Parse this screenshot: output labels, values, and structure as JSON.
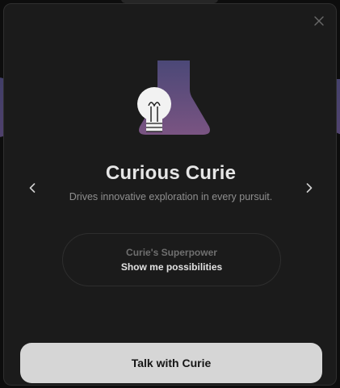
{
  "persona": {
    "name": "Curious Curie",
    "tagline": "Drives innovative exploration in every pursuit.",
    "art_icons": [
      "lightbulb-icon",
      "flask-icon"
    ]
  },
  "superpower": {
    "label": "Curie's Superpower",
    "value": "Show me possibilities"
  },
  "cta": {
    "label": "Talk with Curie"
  },
  "controls": {
    "close_icon": "close-icon",
    "prev_icon": "chevron-left-icon",
    "next_icon": "chevron-right-icon"
  },
  "colors": {
    "modal_background": "#1b1b1b",
    "flask_gradient_top": "#4b4877",
    "flask_gradient_bottom": "#7a5482",
    "cta_background": "#d6d6d6",
    "title_text": "#e6e6e6"
  }
}
